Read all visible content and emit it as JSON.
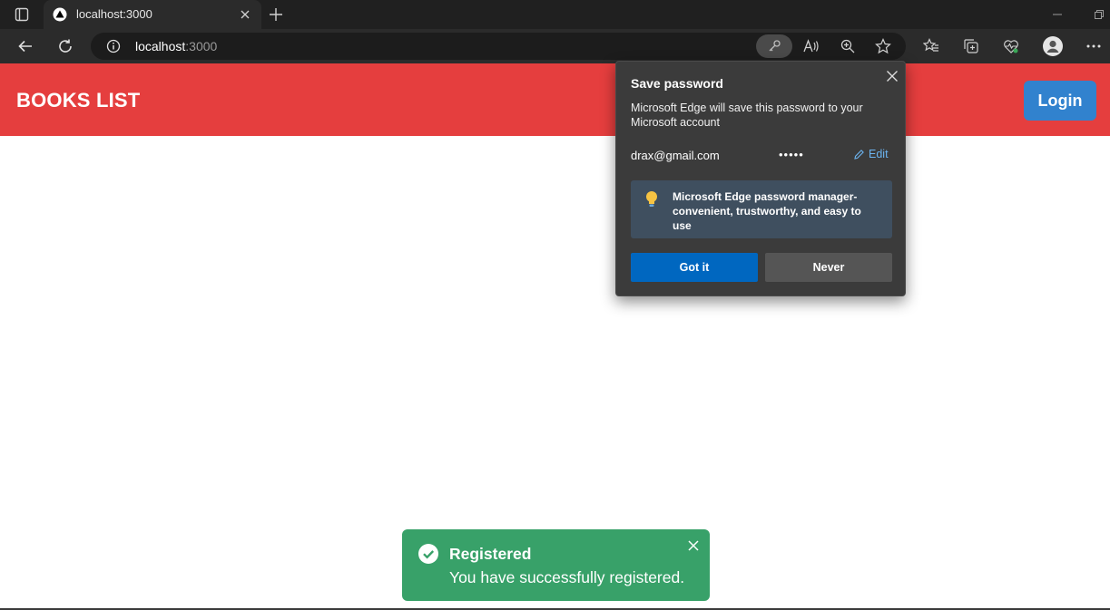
{
  "browser": {
    "tab": {
      "title": "localhost:3000"
    },
    "address": {
      "host": "localhost",
      "port": ":3000"
    }
  },
  "page": {
    "brand": "BOOKS LIST",
    "login_label": "Login",
    "colors": {
      "header": "#e53e3e",
      "login": "#3182ce",
      "toast": "#38a169"
    }
  },
  "password_popup": {
    "title": "Save password",
    "description": "Microsoft Edge will save this password to your Microsoft account",
    "email": "drax@gmail.com",
    "masked_password": "•••••",
    "edit_label": "Edit",
    "tip": "Microsoft Edge password manager- convenient, trustworthy, and easy to use",
    "got_it_label": "Got it",
    "never_label": "Never"
  },
  "toast": {
    "title": "Registered",
    "description": "You have successfully registered."
  }
}
